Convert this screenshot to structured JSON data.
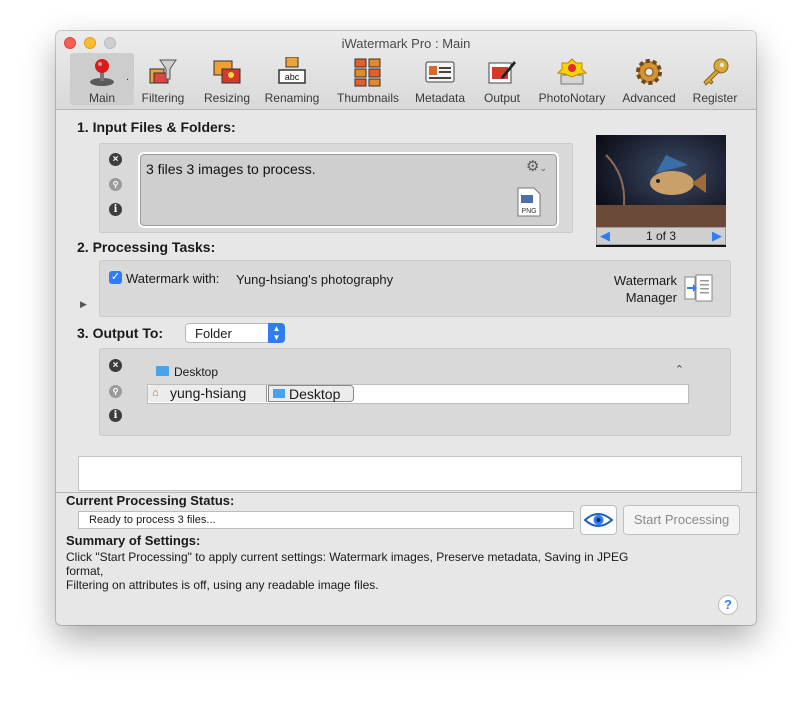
{
  "window": {
    "title": "iWatermark Pro : Main"
  },
  "toolbar": {
    "items": [
      {
        "label": "Main",
        "icon": "joystick-icon"
      },
      {
        "label": "Filtering",
        "icon": "funnel-icon"
      },
      {
        "label": "Resizing",
        "icon": "resize-photos-icon"
      },
      {
        "label": "Renaming",
        "icon": "rename-abc-icon",
        "icon_text": "abc"
      },
      {
        "label": "Thumbnails",
        "icon": "thumbnails-grid-icon"
      },
      {
        "label": "Metadata",
        "icon": "id-card-icon"
      },
      {
        "label": "Output",
        "icon": "output-pen-icon"
      },
      {
        "label": "PhotoNotary",
        "icon": "notary-seal-icon"
      },
      {
        "label": "Advanced",
        "icon": "gear-icon"
      },
      {
        "label": "Register",
        "icon": "key-icon"
      }
    ],
    "active": "Main",
    "dot_left": ".",
    "dot_right": "."
  },
  "input": {
    "heading": "1. Input Files & Folders:",
    "status_text": "3 files 3 images to process.",
    "file_badge": "PNG",
    "preview_counter": "1 of 3"
  },
  "tasks": {
    "heading": "2. Processing Tasks:",
    "watermark_checkbox_label": "Watermark with:",
    "watermark_checked": true,
    "watermark_name": "Yung-hsiang's photography",
    "manager_label_line1": "Watermark",
    "manager_label_line2": "Manager"
  },
  "output": {
    "heading": "3. Output To:",
    "destination_type": "Folder",
    "folder_popup": "Desktop",
    "path": [
      "yung-hsiang",
      "Desktop"
    ]
  },
  "status": {
    "heading": "Current Processing Status:",
    "message": "Ready to process 3 files...",
    "start_button": "Start Processing"
  },
  "summary": {
    "heading": "Summary of Settings:",
    "line1": "Click \"Start Processing\" to apply current settings: Watermark images, Preserve metadata, Saving in JPEG",
    "line2": "format,",
    "line3": "Filtering on attributes is off, using any readable image files."
  },
  "help": {
    "label": "?"
  },
  "colors": {
    "accent": "#2f7df6",
    "window_bg": "#e7e7e7",
    "panel_bg": "#d9d9d9"
  }
}
